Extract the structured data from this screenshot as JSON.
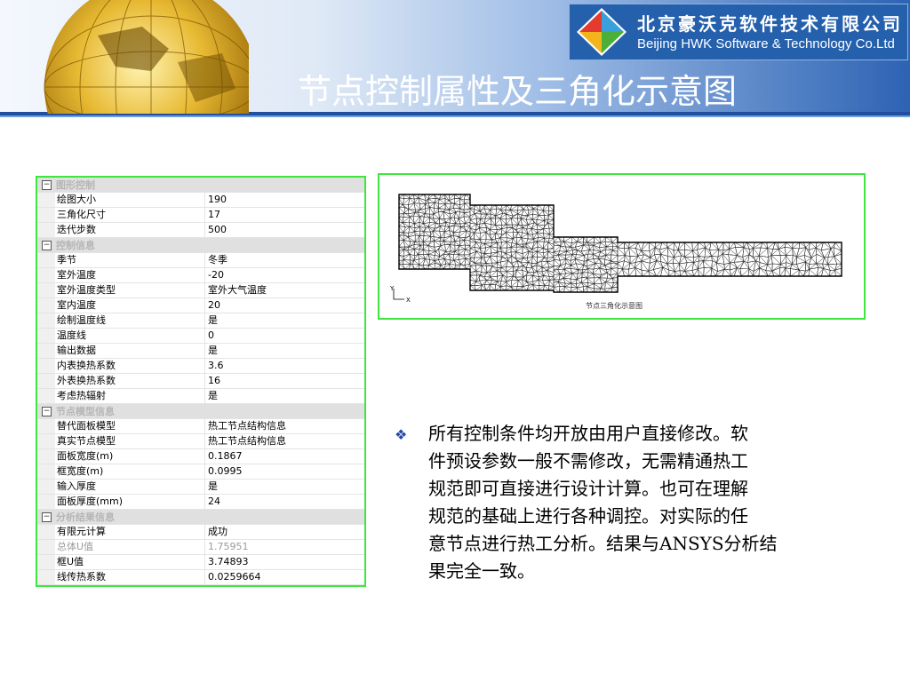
{
  "header": {
    "company_cn": "北京豪沃克软件技术有限公司",
    "company_en": "Beijing HWK Software & Technology Co.Ltd",
    "title": "节点控制属性及三角化示意图"
  },
  "property_grid": {
    "categories": [
      {
        "name": "图形控制",
        "toggle": "⊟",
        "rows": [
          {
            "key": "绘图大小",
            "value": "190"
          },
          {
            "key": "三角化尺寸",
            "value": "17"
          },
          {
            "key": "迭代步数",
            "value": "500"
          }
        ]
      },
      {
        "name": "控制信息",
        "toggle": "⊟",
        "rows": [
          {
            "key": "季节",
            "value": "冬季"
          },
          {
            "key": "室外温度",
            "value": "-20"
          },
          {
            "key": "室外温度类型",
            "value": "室外大气温度"
          },
          {
            "key": "室内温度",
            "value": "20"
          },
          {
            "key": "绘制温度线",
            "value": "是"
          },
          {
            "key": "温度线",
            "value": "0"
          },
          {
            "key": "输出数据",
            "value": "是"
          },
          {
            "key": "内表换热系数",
            "value": "3.6"
          },
          {
            "key": "外表换热系数",
            "value": "16"
          },
          {
            "key": "考虑热辐射",
            "value": "是"
          }
        ]
      },
      {
        "name": "节点模型信息",
        "toggle": "⊟",
        "rows": [
          {
            "key": "替代面板模型",
            "value": "热工节点结构信息"
          },
          {
            "key": "真实节点模型",
            "value": "热工节点结构信息"
          },
          {
            "key": "面板宽度(m)",
            "value": "0.1867"
          },
          {
            "key": "框宽度(m)",
            "value": "0.0995"
          },
          {
            "key": "输入厚度",
            "value": "是"
          },
          {
            "key": "面板厚度(mm)",
            "value": "24"
          }
        ]
      },
      {
        "name": "分析结果信息",
        "toggle": "⊟",
        "rows": [
          {
            "key": "有限元计算",
            "value": "成功"
          },
          {
            "key": "总体U值",
            "value": "1.75951",
            "dim": true
          },
          {
            "key": "框U值",
            "value": "3.74893"
          },
          {
            "key": "线传热系数",
            "value": "0.0259664"
          }
        ]
      }
    ]
  },
  "mesh_figure": {
    "caption": "节点三角化示意图",
    "axis_y": "Y",
    "axis_x": "X"
  },
  "description": {
    "bullet_icon": "diamond-bullet-icon",
    "lines": [
      "所有控制条件均开放由用户直接修改。软",
      "件预设参数一般不需修改，无需精通热工",
      "规范即可直接进行设计计算。也可在理解",
      "规范的基础上进行各种调控。对实际的任",
      "意节点进行热工分析。结果与ANSYS分析结",
      "果完全一致。"
    ]
  },
  "colors": {
    "header_blue": "#2560ad",
    "frame_green": "#3ce83c",
    "title_text": "#ffffff"
  }
}
